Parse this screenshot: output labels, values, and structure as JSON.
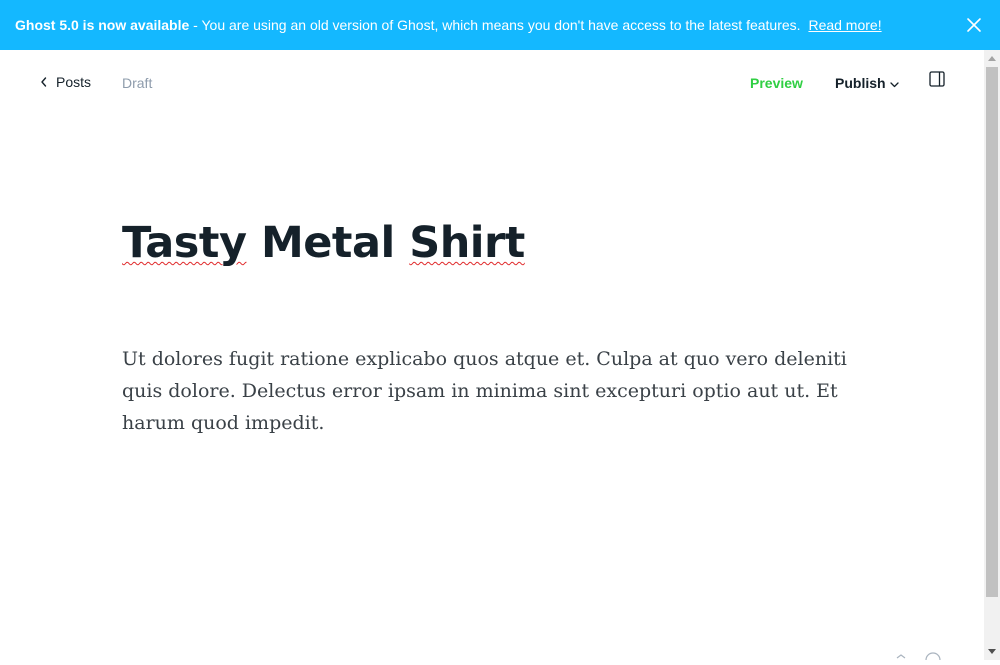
{
  "banner": {
    "strong_text": "Ghost 5.0 is now available",
    "message": " - You are using an old version of Ghost, which means you don't have access to the latest features. ",
    "link_text": "Read more!",
    "background": "#14b8ff"
  },
  "topbar": {
    "back_label": "Posts",
    "status": "Draft",
    "preview_label": "Preview",
    "publish_label": "Publish",
    "preview_color": "#30cf43"
  },
  "post": {
    "title_word_1": "Tasty",
    "title_word_2": "Metal",
    "title_word_3": "Shirt",
    "body": "Ut dolores fugit ratione explicabo quos atque et. Culpa at quo vero deleniti quis dolore. Delectus error ipsam in minima sint excepturi optio aut ut. Et harum quod impedit."
  },
  "icons": {
    "banner_close": "close-icon",
    "back": "chevron-left-icon",
    "publish_dropdown": "chevron-down-icon",
    "sidebar_toggle": "sidebar-toggle-icon",
    "help": "help-icon"
  }
}
